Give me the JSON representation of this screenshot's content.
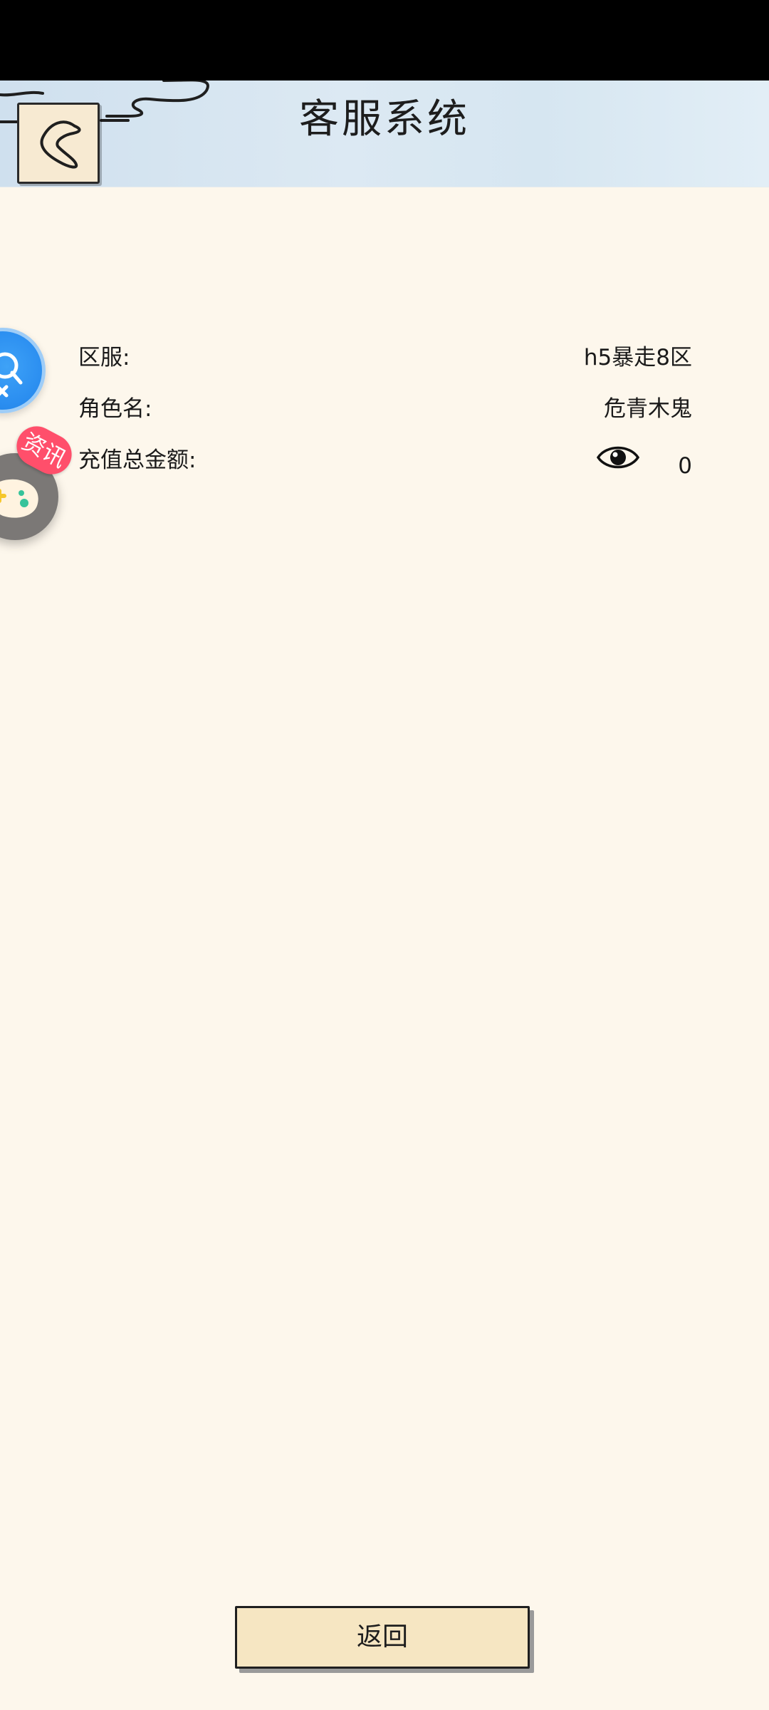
{
  "header": {
    "title": "客服系统",
    "back_icon": "chevron-left-icon"
  },
  "floating": {
    "customer_service_icon": "customer-service-icon",
    "news_badge": "资讯",
    "news_icon": "gamepad-icon"
  },
  "info": {
    "server": {
      "label": "区服:",
      "value": "h5暴走8区"
    },
    "role": {
      "label": "角色名:",
      "value": "危青木鬼"
    },
    "recharge": {
      "label": "充值总金额:",
      "value": "0",
      "icon": "eye-icon"
    }
  },
  "footer": {
    "return_label": "返回"
  },
  "colors": {
    "background": "#fdf7ec",
    "header": "#d6e6f1",
    "button": "#f6e6c2",
    "badge": "#ff4f6b",
    "float_blue": "#2b8ef0"
  }
}
